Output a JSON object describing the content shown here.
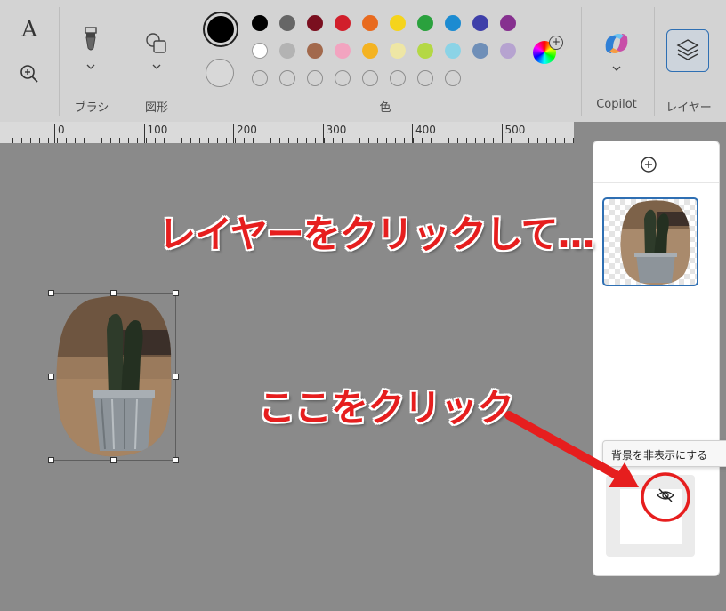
{
  "ribbon": {
    "groups": {
      "brush": "ブラシ",
      "shapes": "図形",
      "colors": "色",
      "copilot": "Copilot",
      "layers": "レイヤー"
    },
    "icons": {
      "text": "text-tool-icon",
      "zoom": "zoom-icon",
      "brush": "brush-icon",
      "shapes": "shapes-icon",
      "color_picker": "color-wheel-add-icon",
      "copilot": "copilot-icon",
      "layers": "layers-icon"
    },
    "text_tool_glyph": "A",
    "primary_color": "#000000",
    "secondary_color": "#ffffff",
    "palette_row1": [
      "#000000",
      "#666666",
      "#7a0f1f",
      "#d11f2b",
      "#e86a1e",
      "#f5d41c",
      "#2aa13d",
      "#1c8bd1",
      "#3e3fa9",
      "#86308f"
    ],
    "palette_row2": [
      "#ffffff",
      "#b3b3b3",
      "#a2694c",
      "#f2a4c0",
      "#f4b322",
      "#eee6a5",
      "#b4d845",
      "#8bd3e6",
      "#6f8fb8",
      "#b6a3d0"
    ]
  },
  "ruler": {
    "labels": [
      "0",
      "100",
      "200",
      "300",
      "400",
      "500"
    ]
  },
  "layers_panel": {
    "add_layer_icon": "add-layer-icon",
    "tooltip": "背景を非表示にする",
    "visibility_icon": "eye-hidden-icon"
  },
  "annotations": {
    "top_text": "レイヤーをクリックして…",
    "bottom_text": "ここをクリック",
    "highlight_color": "#e61e1e"
  }
}
